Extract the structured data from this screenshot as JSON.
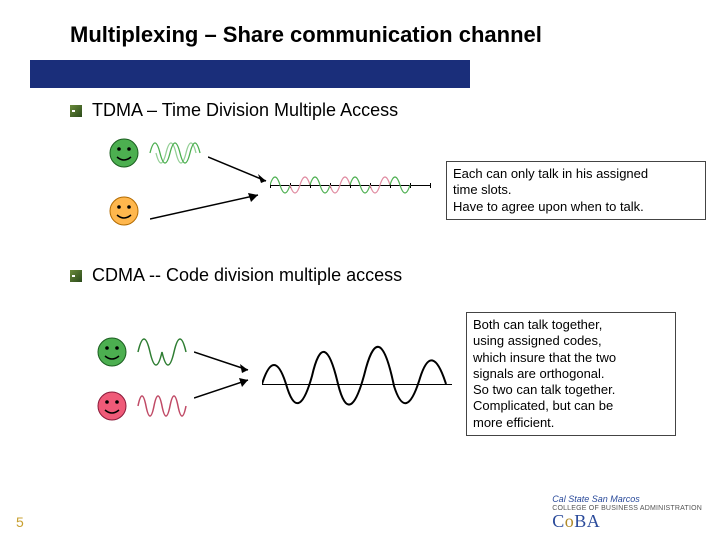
{
  "title": "Multiplexing – Share communication channel",
  "tdma": {
    "heading": "TDMA – Time Division Multiple Access",
    "callout_line1": "Each can only talk in his assigned",
    "callout_line2": "time slots.",
    "callout_line3": "Have to agree upon when to talk."
  },
  "cdma": {
    "heading": "CDMA -- Code division multiple access",
    "callout_line1": "Both can talk together,",
    "callout_line2": "using assigned codes,",
    "callout_line3": "which insure that the two",
    "callout_line4": "signals are orthogonal.",
    "callout_line5": "So two can talk together.",
    "callout_line6": "Complicated, but can be",
    "callout_line7": "more efficient."
  },
  "page_number": "5",
  "logo": {
    "univ": "Cal State San Marcos",
    "college": "COLLEGE OF BUSINESS ADMINISTRATION",
    "brand_c": "C",
    "brand_o": "o",
    "brand_ba": "BA"
  }
}
